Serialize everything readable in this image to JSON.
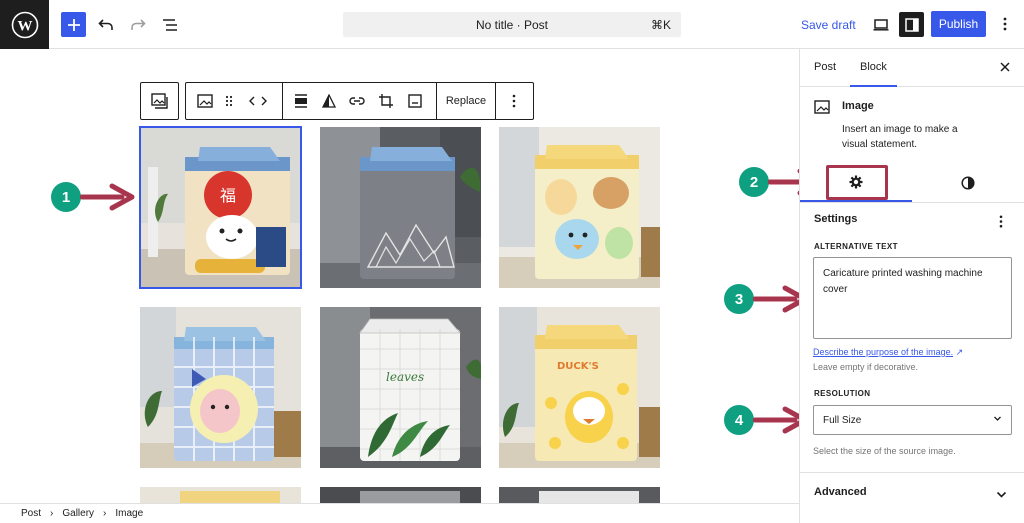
{
  "topbar": {
    "command_title": "No title · Post",
    "command_shortcut": "⌘K",
    "save_draft": "Save draft",
    "publish": "Publish"
  },
  "block_toolbar": {
    "replace_label": "Replace"
  },
  "gallery": {
    "images": [
      {
        "alt": "Caricature printed washing machine cover",
        "theme": "lucky-cat",
        "cover_color": "#f0e2c2",
        "top_color": "#6a96c9"
      },
      {
        "alt": "",
        "theme": "grey-mountain",
        "cover_color": "#7d8086",
        "top_color": "#6a96c9"
      },
      {
        "alt": "",
        "theme": "cartoon-animals",
        "cover_color": "#f4efc8",
        "top_color": "#f1cf6a"
      },
      {
        "alt": "",
        "theme": "blue-plaid-bear",
        "cover_color": "#b7cbe9",
        "top_color": "#86b4dc"
      },
      {
        "alt": "",
        "theme": "leaves-grid",
        "cover_color": "#f4f4f2",
        "top_color": "#e6e6e6"
      },
      {
        "alt": "",
        "theme": "ducks",
        "cover_color": "#f6e9b4",
        "top_color": "#f1cf6a"
      }
    ]
  },
  "annotations": [
    "1",
    "2",
    "3",
    "4"
  ],
  "sidebar": {
    "tab_post": "Post",
    "tab_block": "Block",
    "block_title": "Image",
    "block_desc_line1": "Insert an image to make a",
    "block_desc_line2": "visual statement.",
    "settings_title": "Settings",
    "alt_label": "ALTERNATIVE TEXT",
    "alt_line1": "Caricature printed washing machine",
    "alt_line2": "cover",
    "alt_help_link": "Describe the purpose of the image.",
    "alt_help_link_icon": "↗",
    "alt_help_note": "Leave empty if decorative.",
    "resolution_label": "RESOLUTION",
    "resolution_value": "Full Size",
    "resolution_help": "Select the size of the source image.",
    "advanced": "Advanced"
  },
  "breadcrumb": {
    "items": [
      "Post",
      "Gallery",
      "Image"
    ],
    "separator": "›"
  },
  "colors": {
    "accent": "#3858e9",
    "annotation_badge": "#0f9f81",
    "annotation_arrow": "#a8354e"
  }
}
